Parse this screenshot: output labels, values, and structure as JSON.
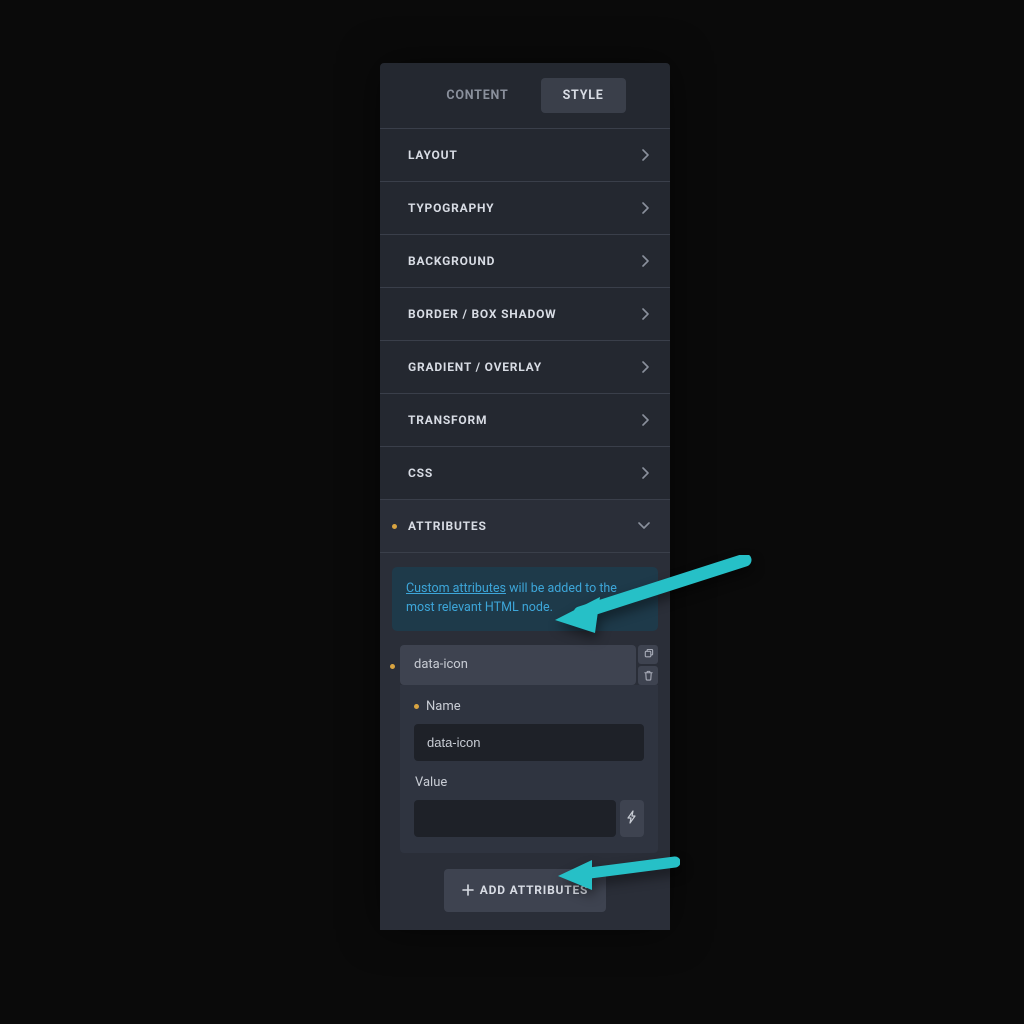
{
  "tabs": {
    "content": "CONTENT",
    "style": "STYLE"
  },
  "sections": {
    "layout": "LAYOUT",
    "typography": "TYPOGRAPHY",
    "background": "BACKGROUND",
    "border": "BORDER / BOX SHADOW",
    "gradient": "GRADIENT / OVERLAY",
    "transform": "TRANSFORM",
    "css": "CSS",
    "attributes": "ATTRIBUTES"
  },
  "info": {
    "link": "Custom attributes",
    "rest": " will be added to the most relevant HTML node."
  },
  "attribute": {
    "chip": "data-icon",
    "name_label": "Name",
    "name_value": "data-icon",
    "value_label": "Value",
    "value_value": ""
  },
  "add_button": "ADD ATTRIBUTES"
}
